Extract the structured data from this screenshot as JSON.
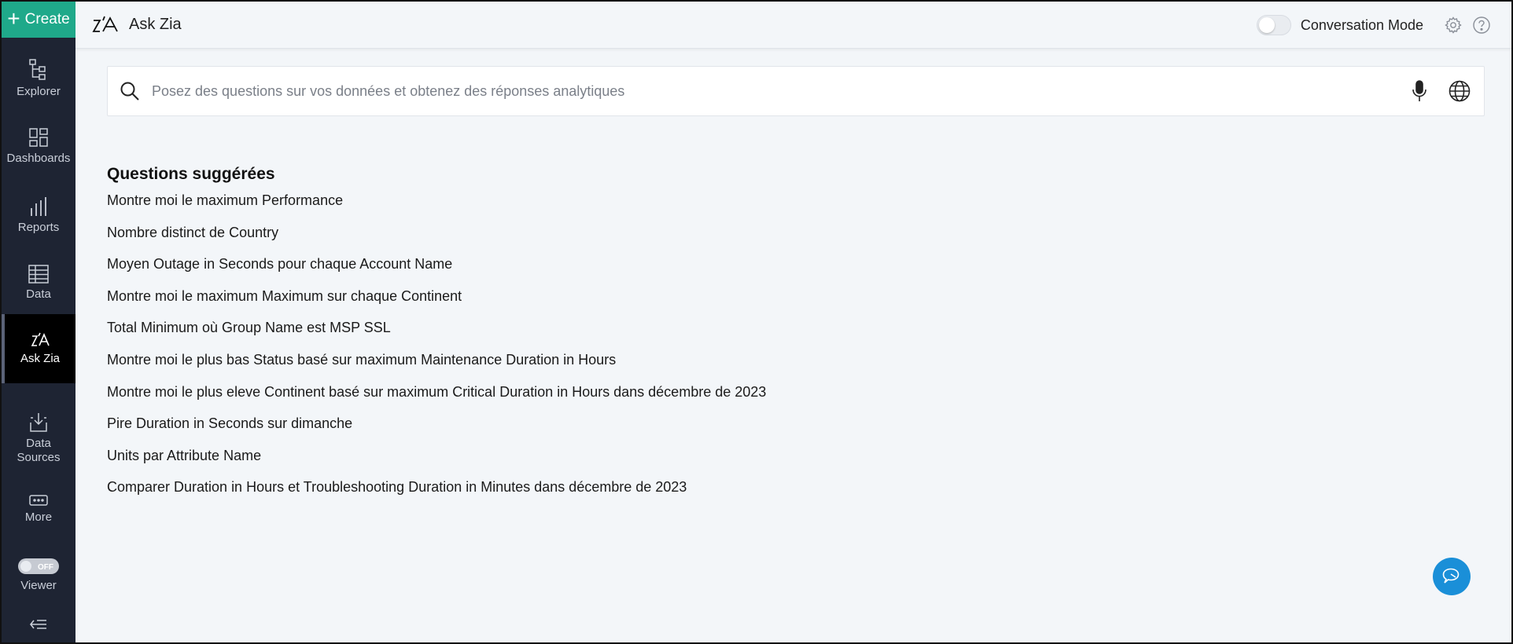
{
  "sidebar": {
    "create_label": "Create",
    "items": [
      {
        "label": "Explorer",
        "icon": "explorer-icon"
      },
      {
        "label": "Dashboards",
        "icon": "dashboards-icon"
      },
      {
        "label": "Reports",
        "icon": "reports-icon"
      },
      {
        "label": "Data",
        "icon": "data-icon"
      },
      {
        "label": "Ask Zia",
        "icon": "ask-zia-icon",
        "active": true
      },
      {
        "label": "Data Sources",
        "icon": "data-sources-icon"
      },
      {
        "label": "More",
        "icon": "more-icon"
      },
      {
        "label": "Viewer",
        "icon": "viewer-toggle",
        "toggle": "OFF"
      }
    ],
    "collapse_icon": "collapse-icon"
  },
  "header": {
    "title": "Ask Zia",
    "conversation_mode_label": "Conversation Mode",
    "conversation_mode_on": false
  },
  "search": {
    "placeholder": "Posez des questions sur vos données et obtenez des réponses analytiques",
    "value": ""
  },
  "suggestions": {
    "heading": "Questions suggérées",
    "items": [
      "Montre moi le maximum Performance",
      "Nombre distinct de Country",
      "Moyen Outage in Seconds pour chaque Account Name",
      "Montre moi le maximum Maximum sur chaque Continent",
      "Total Minimum où Group Name est MSP SSL",
      "Montre moi le plus bas Status basé sur maximum Maintenance Duration in Hours",
      "Montre moi le plus eleve Continent basé sur maximum Critical Duration in Hours dans décembre de 2023",
      "Pire Duration in Seconds sur dimanche",
      "Units par Attribute Name",
      "Comparer Duration in Hours et Troubleshooting Duration in Minutes dans décembre de 2023"
    ]
  },
  "colors": {
    "sidebar_bg": "#1e2433",
    "create_bg": "#1fa98a",
    "active_bg": "#000000",
    "page_bg": "#f3f6f9",
    "fab_bg": "#1a8fd8"
  }
}
